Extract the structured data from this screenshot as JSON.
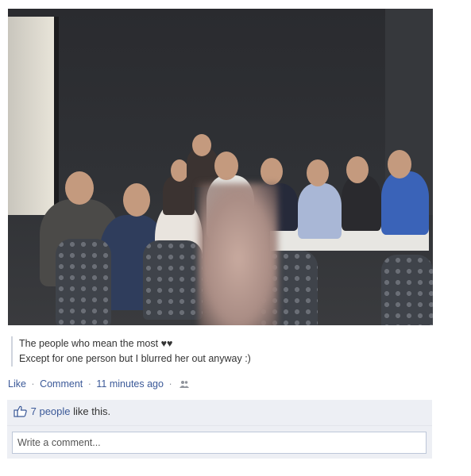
{
  "post": {
    "caption_line1": "The people who mean the most ♥♥",
    "caption_line2": "Except for one person but I blurred her out anyway :)"
  },
  "actions": {
    "like_label": "Like",
    "comment_label": "Comment",
    "separator": "·",
    "timestamp": "11 minutes ago",
    "audience_icon": "friends-icon"
  },
  "likes": {
    "icon": "thumbs-up-icon",
    "count_text": "7 people",
    "suffix": " like this."
  },
  "comment_box": {
    "placeholder": "Write a comment..."
  },
  "colors": {
    "link": "#3b5998",
    "meta": "#90949c",
    "panel_bg": "#edeff4"
  }
}
